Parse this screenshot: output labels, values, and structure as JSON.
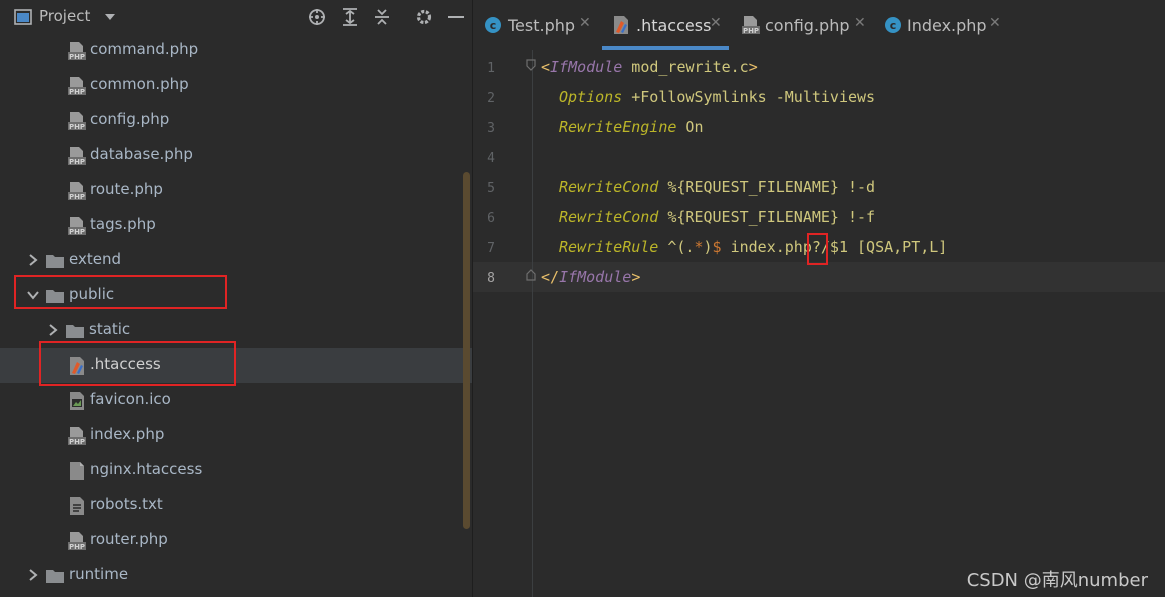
{
  "project": {
    "title": "Project",
    "tree": [
      {
        "label": "command.php",
        "type": "php",
        "indent": 2
      },
      {
        "label": "common.php",
        "type": "php",
        "indent": 2
      },
      {
        "label": "config.php",
        "type": "php",
        "indent": 2
      },
      {
        "label": "database.php",
        "type": "php",
        "indent": 2
      },
      {
        "label": "route.php",
        "type": "php",
        "indent": 2
      },
      {
        "label": "tags.php",
        "type": "php",
        "indent": 2
      },
      {
        "label": "extend",
        "type": "folder",
        "indent": 1,
        "expanded": false
      },
      {
        "label": "public",
        "type": "folder",
        "indent": 1,
        "expanded": true
      },
      {
        "label": "static",
        "type": "folder",
        "indent": 2,
        "expanded": false
      },
      {
        "label": ".htaccess",
        "type": "htaccess",
        "indent": 2,
        "selected": true
      },
      {
        "label": "favicon.ico",
        "type": "ico",
        "indent": 2
      },
      {
        "label": "index.php",
        "type": "php",
        "indent": 2
      },
      {
        "label": "nginx.htaccess",
        "type": "file",
        "indent": 2
      },
      {
        "label": "robots.txt",
        "type": "text",
        "indent": 2
      },
      {
        "label": "router.php",
        "type": "php",
        "indent": 2
      },
      {
        "label": "runtime",
        "type": "folder",
        "indent": 1,
        "expanded": false
      }
    ]
  },
  "tabs": [
    {
      "label": "Test.php",
      "icon": "class-c-icon",
      "active": false
    },
    {
      "label": ".htaccess",
      "icon": "htaccess-icon",
      "active": true
    },
    {
      "label": "config.php",
      "icon": "php-file-icon",
      "active": false
    },
    {
      "label": "Index.php",
      "icon": "class-c-icon",
      "active": false
    }
  ],
  "editor": {
    "line_numbers": [
      "1",
      "2",
      "3",
      "4",
      "5",
      "6",
      "7",
      "8"
    ],
    "lines": {
      "l1_open": "<",
      "l1_tag": "IfModule",
      "l1_arg": " mod_rewrite.c",
      "l1_close": ">",
      "l2_dir": "Options",
      "l2_arg": " +FollowSymlinks -Multiviews",
      "l3_dir": "RewriteEngine",
      "l3_arg": " On",
      "l5_dir": "RewriteCond",
      "l5_arg": " %{REQUEST_FILENAME} !-d",
      "l6_dir": "RewriteCond",
      "l6_arg": " %{REQUEST_FILENAME} !-f",
      "l7_dir": "RewriteRule",
      "l7_a": " ^(.",
      "l7_b": "*",
      "l7_c": ")",
      "l7_d": "$",
      "l7_e": " index.php?/$1 [QSA,PT,L]",
      "l8_open": "</",
      "l8_tag": "IfModule",
      "l8_close": ">"
    }
  },
  "watermark": "CSDN @南风number",
  "colors": {
    "background": "#2b2b2b",
    "selection": "#3a3d40",
    "highlight_box": "#e02424",
    "active_tab_underline": "#4a88c7"
  }
}
